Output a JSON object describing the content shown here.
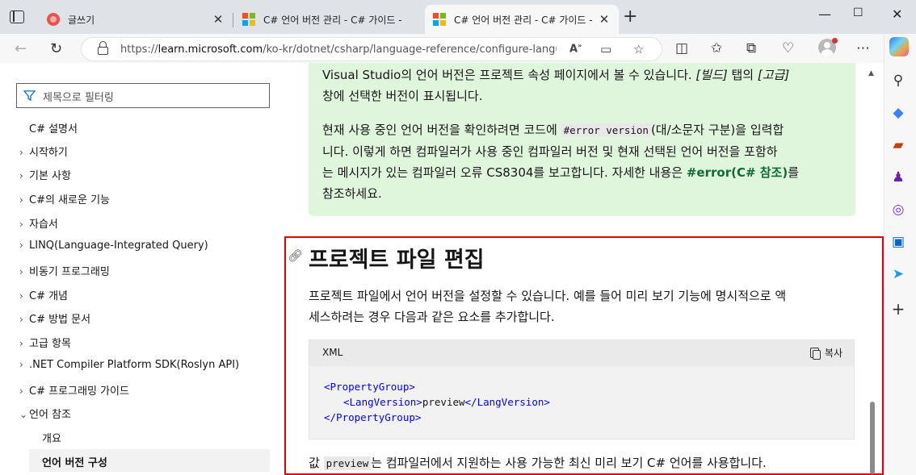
{
  "browser": {
    "tabs": [
      {
        "title": "글쓰기",
        "favicon": "red-circle-icon",
        "active": false
      },
      {
        "title": "C# 언어 버전 관리 - C# 가이드 -",
        "favicon": "microsoft-logo-icon",
        "active": false
      },
      {
        "title": "C# 언어 버전 관리 - C# 가이드 -",
        "favicon": "microsoft-logo-icon",
        "active": true
      }
    ],
    "url_prefix": "https://",
    "url_host": "learn.microsoft.com",
    "url_path": "/ko-kr/dotnet/csharp/language-reference/configure-langu...",
    "window_buttons": [
      "—",
      "☐",
      "✕"
    ]
  },
  "sidebar": {
    "filter_placeholder": "제목으로 필터링",
    "items": [
      {
        "label": "C# 설명서",
        "chevron": ""
      },
      {
        "label": "시작하기",
        "chevron": "›"
      },
      {
        "label": "기본 사항",
        "chevron": "›"
      },
      {
        "label": "C#의 새로운 기능",
        "chevron": "›"
      },
      {
        "label": "자습서",
        "chevron": "›"
      },
      {
        "label": "LINQ(Language-Integrated Query)",
        "chevron": "›"
      },
      {
        "label": "비동기 프로그래밍",
        "chevron": "›"
      },
      {
        "label": "C# 개념",
        "chevron": "›"
      },
      {
        "label": "C# 방법 문서",
        "chevron": "›"
      },
      {
        "label": "고급 항목",
        "chevron": "›"
      },
      {
        "label": ".NET Compiler Platform SDK(Roslyn API)",
        "chevron": "›"
      },
      {
        "label": "C# 프로그래밍 가이드",
        "chevron": "›"
      },
      {
        "label": "언어 참조",
        "chevron": "⌄"
      },
      {
        "label": "개요",
        "chevron": ""
      },
      {
        "label": "언어 버전 구성",
        "chevron": ""
      }
    ]
  },
  "content": {
    "note_p1_a": "Visual Studio의 언어 버전은 프로젝트 속성 페이지에서 볼 수 있습니다. ",
    "note_p1_b": "[빌드]",
    "note_p1_c": " 탭의 ",
    "note_p1_d": "[고급]",
    "note_p1_e": "창에 선택한 버전이 표시됩니다.",
    "note_p2_a": "현재 사용 중인 언어 버전을 확인하려면 코드에 ",
    "note_p2_code": "#error version",
    "note_p2_b": "(대/소문자 구분)을 입력합",
    "note_p2_c": "니다. 이렇게 하면 컴파일러가 사용 중인 컴파일러 버전 및 현재 선택된 언어 버전을 포함하",
    "note_p2_d": "는 메시지가 있는 컴파일러 오류 CS8304를 보고합니다. 자세한 내용은 ",
    "note_p2_link": "#error(C# 참조)",
    "note_p2_e": "를",
    "note_p2_f": "참조하세요.",
    "heading": "프로젝트 파일 편집",
    "para1_a": "프로젝트 파일에서 언어 버전을 설정할 수 있습니다. 예를 들어 미리 보기 기능에 명시적으로 액",
    "para1_b": "세스하려는 경우 다음과 같은 요소를 추가합니다.",
    "code_lang": "XML",
    "copy_label": "복사",
    "code": {
      "l1": "<PropertyGroup>",
      "l2_open": "<LangVersion>",
      "l2_text": "preview",
      "l2_close": "</LangVersion>",
      "l3": "</PropertyGroup>"
    },
    "para2_a": "값 ",
    "para2_code": "preview",
    "para2_b": "는 컴파일러에서 지원하는 사용 가능한 최신 미리 보기 C# 언어를 사용합니다."
  },
  "colors": {
    "note_bg": "#dff6dd",
    "highlight": "#e00000",
    "xml_tag": "#0101fd",
    "link": "#0f6a3a"
  }
}
